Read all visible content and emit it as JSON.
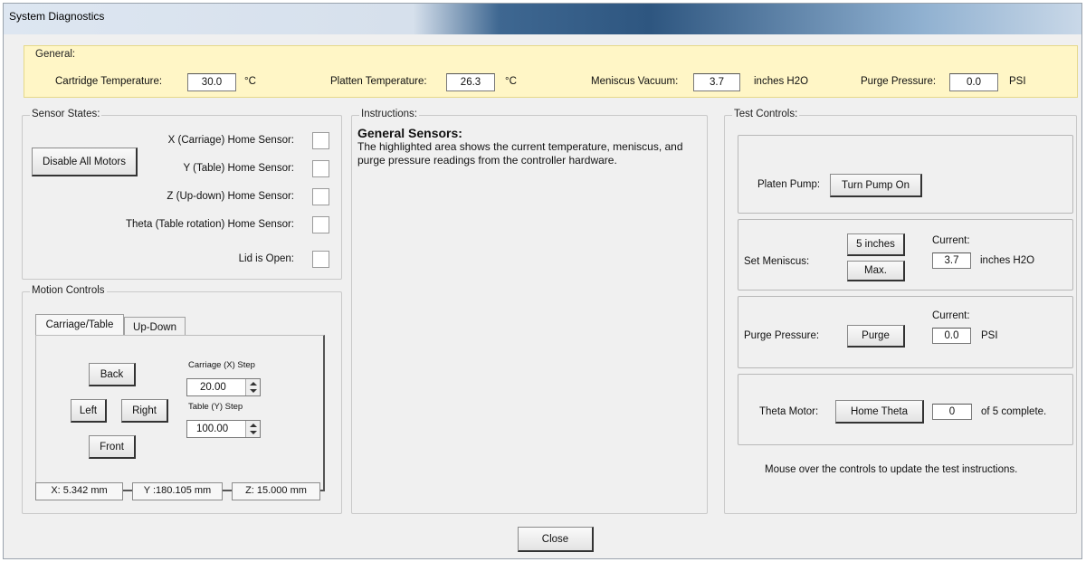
{
  "window": {
    "title": "System Diagnostics"
  },
  "general": {
    "legend": "General:",
    "cartridge_label": "Cartridge Temperature:",
    "cartridge_value": "30.0",
    "cartridge_unit": "°C",
    "platen_label": "Platten Temperature:",
    "platen_value": "26.3",
    "platen_unit": "°C",
    "meniscus_label": "Meniscus Vacuum:",
    "meniscus_value": "3.7",
    "meniscus_unit": "inches H2O",
    "purge_label": "Purge Pressure:",
    "purge_value": "0.0",
    "purge_unit": "PSI"
  },
  "sensors": {
    "legend": "Sensor States:",
    "disable_button": "Disable All Motors",
    "items": [
      {
        "label": "X (Carriage) Home Sensor:"
      },
      {
        "label": "Y (Table) Home Sensor:"
      },
      {
        "label": "Z (Up-down) Home Sensor:"
      },
      {
        "label": "Theta (Table rotation) Home Sensor:"
      },
      {
        "label": "Lid is Open:"
      }
    ]
  },
  "motion": {
    "legend": "Motion Controls",
    "tabs": [
      {
        "label": "Carriage/Table"
      },
      {
        "label": "Up-Down"
      }
    ],
    "back": "Back",
    "left": "Left",
    "right": "Right",
    "front": "Front",
    "carriage_step_label": "Carriage (X) Step",
    "carriage_step_value": "20.00",
    "table_step_label": "Table (Y) Step",
    "table_step_value": "100.00",
    "status": {
      "x": "X: 5.342 mm",
      "y": "Y :180.105 mm",
      "z": "Z: 15.000 mm"
    }
  },
  "instructions": {
    "legend": "Instructions:",
    "heading": "General Sensors:",
    "body": "The highlighted area shows the current temperature, meniscus, and purge pressure readings from the controller hardware."
  },
  "tests": {
    "legend": "Test Controls:",
    "platen_pump_label": "Platen Pump:",
    "platen_pump_button": "Turn Pump On",
    "set_meniscus_label": "Set Meniscus:",
    "meniscus_5in_button": "5 inches",
    "meniscus_max_button": "Max.",
    "current_label": "Current:",
    "meniscus_current_value": "3.7",
    "meniscus_current_unit": "inches H2O",
    "purge_label": "Purge Pressure:",
    "purge_button": "Purge",
    "purge_current_value": "0.0",
    "purge_current_unit": "PSI",
    "theta_label": "Theta Motor:",
    "theta_button": "Home Theta",
    "theta_value": "0",
    "theta_suffix": "of 5 complete.",
    "hint": "Mouse over the controls to update the test instructions."
  },
  "footer": {
    "close": "Close"
  },
  "colors": {
    "highlight": "#fff6c6",
    "titlebar_blue": "#2e5680"
  }
}
